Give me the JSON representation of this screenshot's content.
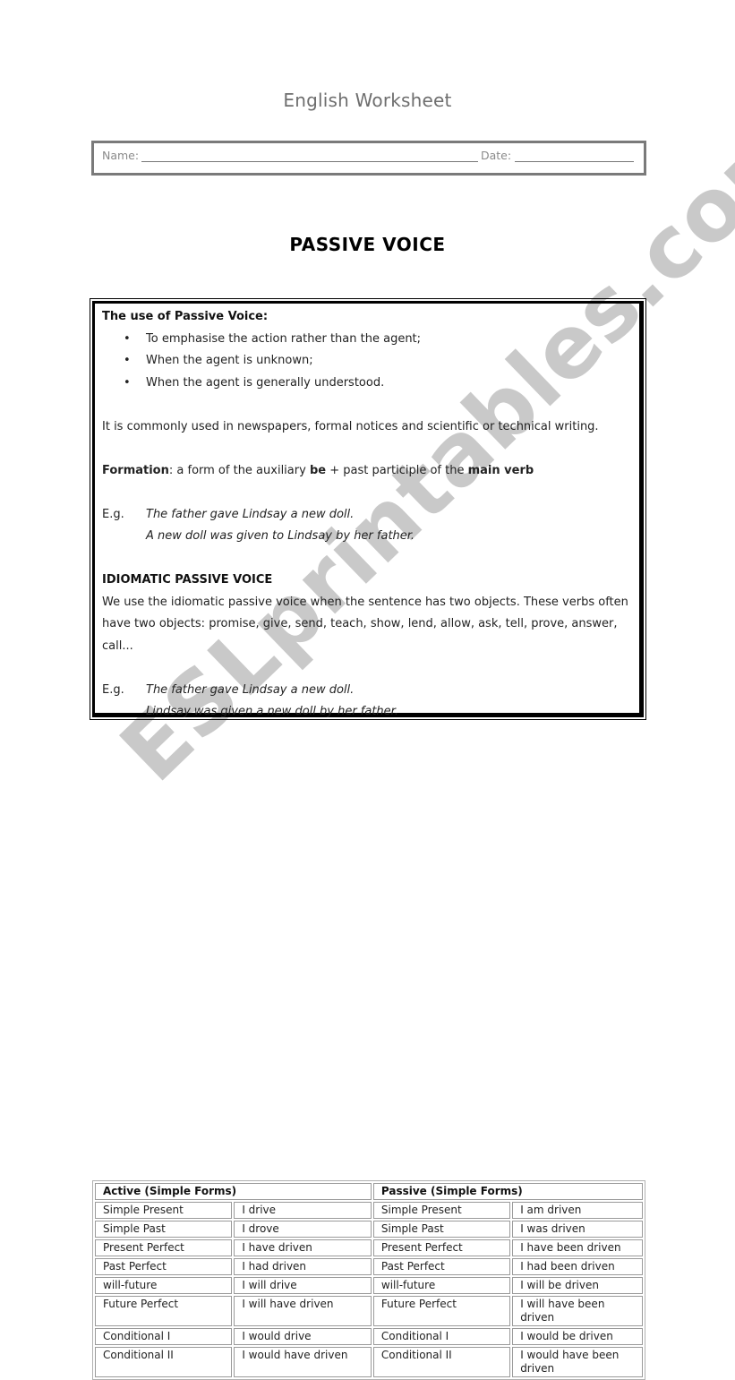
{
  "header": {
    "title": "English Worksheet",
    "name_label": "Name:",
    "date_label": "Date:"
  },
  "document": {
    "title": "PASSIVE VOICE"
  },
  "box": {
    "use_heading": "The use of Passive Voice:",
    "uses": [
      "To emphasise the action rather than the agent;",
      "When the agent is unknown;",
      "When the agent is generally understood."
    ],
    "common_use": "It is commonly used in newspapers, formal notices and scientific or technical writing.",
    "formation": {
      "label": "Formation",
      "part1": ": a form of the auxiliary ",
      "bold1": "be",
      "part2": " + past participle of the ",
      "bold2": "main verb"
    },
    "example1": {
      "label": "E.g.",
      "active": "The father gave Lindsay a new doll.",
      "passive": "A new doll was given to Lindsay by her father."
    },
    "idiomatic_heading": "IDIOMATIC PASSIVE VOICE",
    "idiomatic_text": "We use the idiomatic passive voice when the sentence has two objects. These verbs often have two objects: promise, give, send, teach, show, lend, allow, ask, tell, prove, answer, call...",
    "example2": {
      "label": "E.g.",
      "active": "The father gave Lindsay a new doll.",
      "passive": "Lindsay was given a new doll by her father."
    }
  },
  "table": {
    "active_header": "Active (Simple Forms)",
    "passive_header": "Passive (Simple Forms)",
    "rows": [
      {
        "tense": "Simple Present",
        "active": "I drive",
        "passive_tense": "Simple Present",
        "passive": "I am driven"
      },
      {
        "tense": "Simple Past",
        "active": "I drove",
        "passive_tense": "Simple Past",
        "passive": "I was driven"
      },
      {
        "tense": "Present Perfect",
        "active": "I have driven",
        "passive_tense": "Present Perfect",
        "passive": "I have been driven"
      },
      {
        "tense": "Past Perfect",
        "active": "I had driven",
        "passive_tense": "Past Perfect",
        "passive": "I had been driven"
      },
      {
        "tense": "will-future",
        "active": "I will drive",
        "passive_tense": "will-future",
        "passive": "I will be driven"
      },
      {
        "tense": "Future Perfect",
        "active": "I will have driven",
        "passive_tense": "Future Perfect",
        "passive": "I will have been driven"
      },
      {
        "tense": "Conditional I",
        "active": "I would drive",
        "passive_tense": "Conditional I",
        "passive": "I would be driven"
      },
      {
        "tense": "Conditional II",
        "active": "I would have driven",
        "passive_tense": "Conditional II",
        "passive": "I would have been driven"
      }
    ]
  },
  "watermark": {
    "text": "ESLprintables.com",
    "color": "#c9c9c9"
  }
}
